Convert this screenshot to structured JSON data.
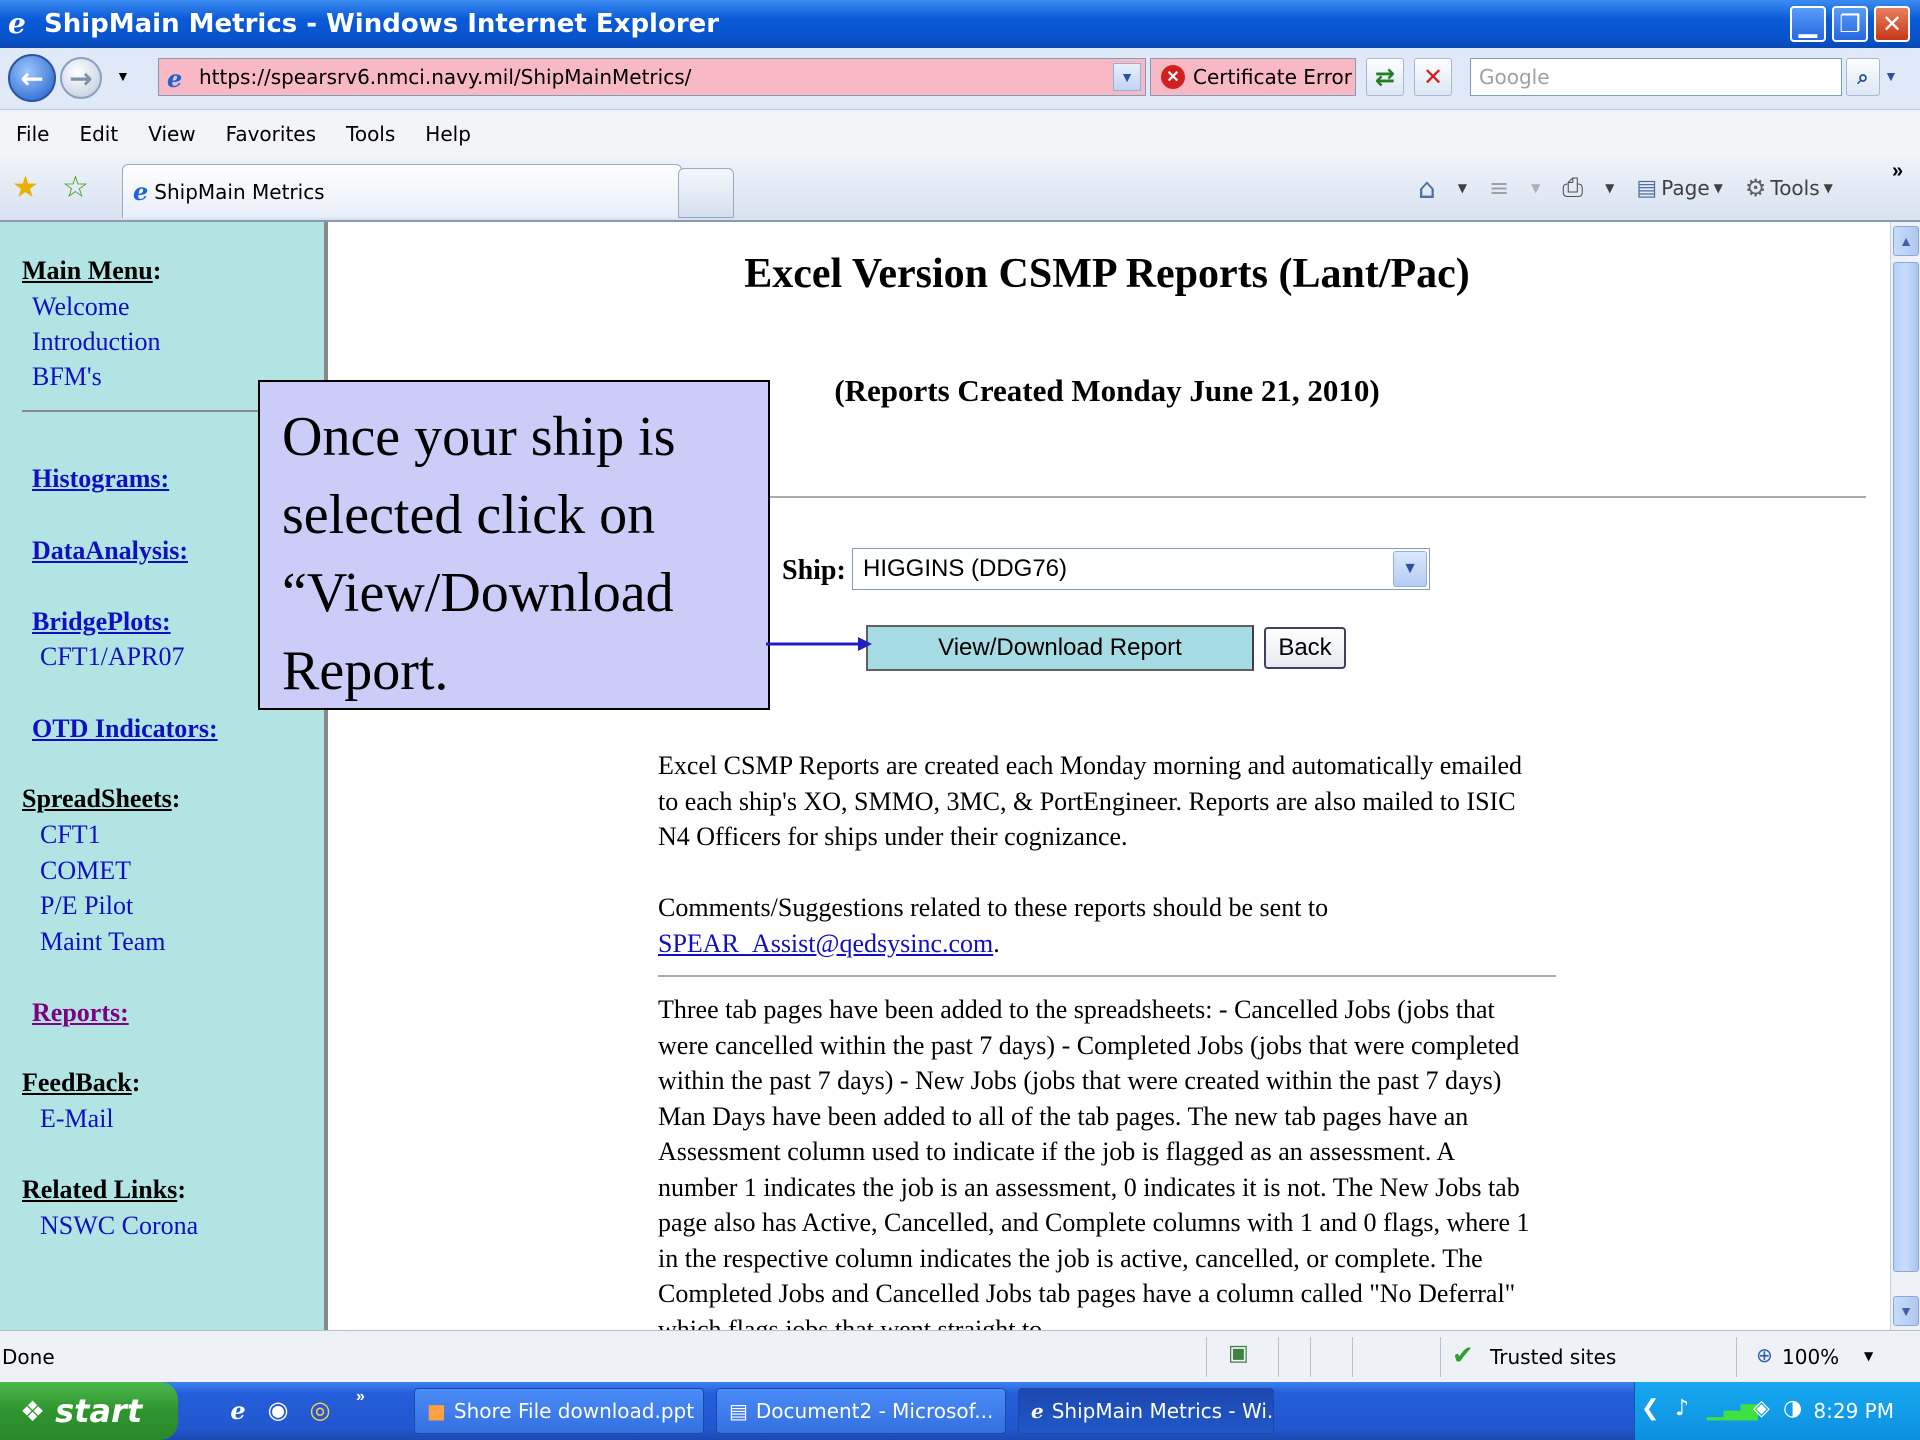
{
  "window": {
    "title": "ShipMain Metrics - Windows Internet Explorer",
    "minimize": "▁",
    "maximize": "❐",
    "close": "✕"
  },
  "address_bar": {
    "url": "https://spearsrv6.nmci.navy.mil/ShipMainMetrics/",
    "cert_error": "Certificate Error",
    "search_placeholder": "Google"
  },
  "menu": [
    "File",
    "Edit",
    "View",
    "Favorites",
    "Tools",
    "Help"
  ],
  "tab": {
    "label": "ShipMain Metrics"
  },
  "command_bar": {
    "page": "Page",
    "tools": "Tools"
  },
  "sidebar": {
    "main_menu": "Main Menu",
    "welcome": "Welcome",
    "introduction": "Introduction",
    "bfms": "BFM's",
    "histograms": "Histograms:",
    "data_analysis": "DataAnalysis:",
    "bridge_plots": "BridgePlots:",
    "cft1_apr07": "CFT1/APR07",
    "otd_indicators": "OTD Indicators:",
    "spreadsheets": "SpreadSheets",
    "cft1": "CFT1",
    "comet": "COMET",
    "pe_pilot": "P/E Pilot",
    "maint_team": "Maint Team",
    "reports": "Reports:",
    "feedback": "FeedBack",
    "email": "E-Mail",
    "related_links": "Related Links",
    "nswc_corona": "NSWC Corona",
    "colon": ":"
  },
  "main": {
    "title": "Excel Version CSMP Reports (Lant/Pac)",
    "subtitle": "(Reports Created Monday June 21, 2010)",
    "ship_label": "Ship:",
    "ship_selected": "HIGGINS (DDG76)",
    "view_button": "View/Download Report",
    "back_button": "Back",
    "para1": "Excel CSMP Reports are created each Monday morning and automatically emailed to each ship's XO, SMMO, 3MC, & PortEngineer. Reports are also mailed to ISIC N4 Officers for ships under their cognizance.",
    "para2_text": "Comments/Suggestions related to these reports should be sent to",
    "para2_email": "SPEAR_Assist@qedsysinc.com",
    "para2_end": ".",
    "para3": "Three tab pages have been added to the spreadsheets: - Cancelled Jobs (jobs that were cancelled within the past 7 days) - Completed Jobs (jobs that were completed within the past 7 days) - New Jobs (jobs that were created within the past 7 days) Man Days have been added to all of the tab pages. The new tab pages have an Assessment column used to indicate if the job is flagged as an assessment. A number 1 indicates the job is an assessment, 0 indicates it is not. The New Jobs tab page also has Active, Cancelled, and Complete columns with 1 and 0 flags, where 1 in the respective column indicates the job is active, cancelled, or complete. The Completed Jobs and Cancelled Jobs tab pages have a column called \"No Deferral\" which flags jobs that went straight to"
  },
  "callout": {
    "text": "Once your ship is selected click on “View/Download Report."
  },
  "status": {
    "done": "Done",
    "zone": "Trusted sites",
    "zoom": "100%"
  },
  "taskbar": {
    "start": "start",
    "items": [
      "Shore File download.ppt",
      "Document2 - Microsof...",
      "ShipMain Metrics - Wi..."
    ],
    "clock": "8:29 PM"
  },
  "colors": {
    "sidebar_bg": "#b2e4e4",
    "callout_bg": "#ccccf8",
    "view_button_bg": "#a8dce4",
    "url_bar_bg": "#f8b8c4",
    "link": "#1010c0",
    "visited": "#800080"
  }
}
